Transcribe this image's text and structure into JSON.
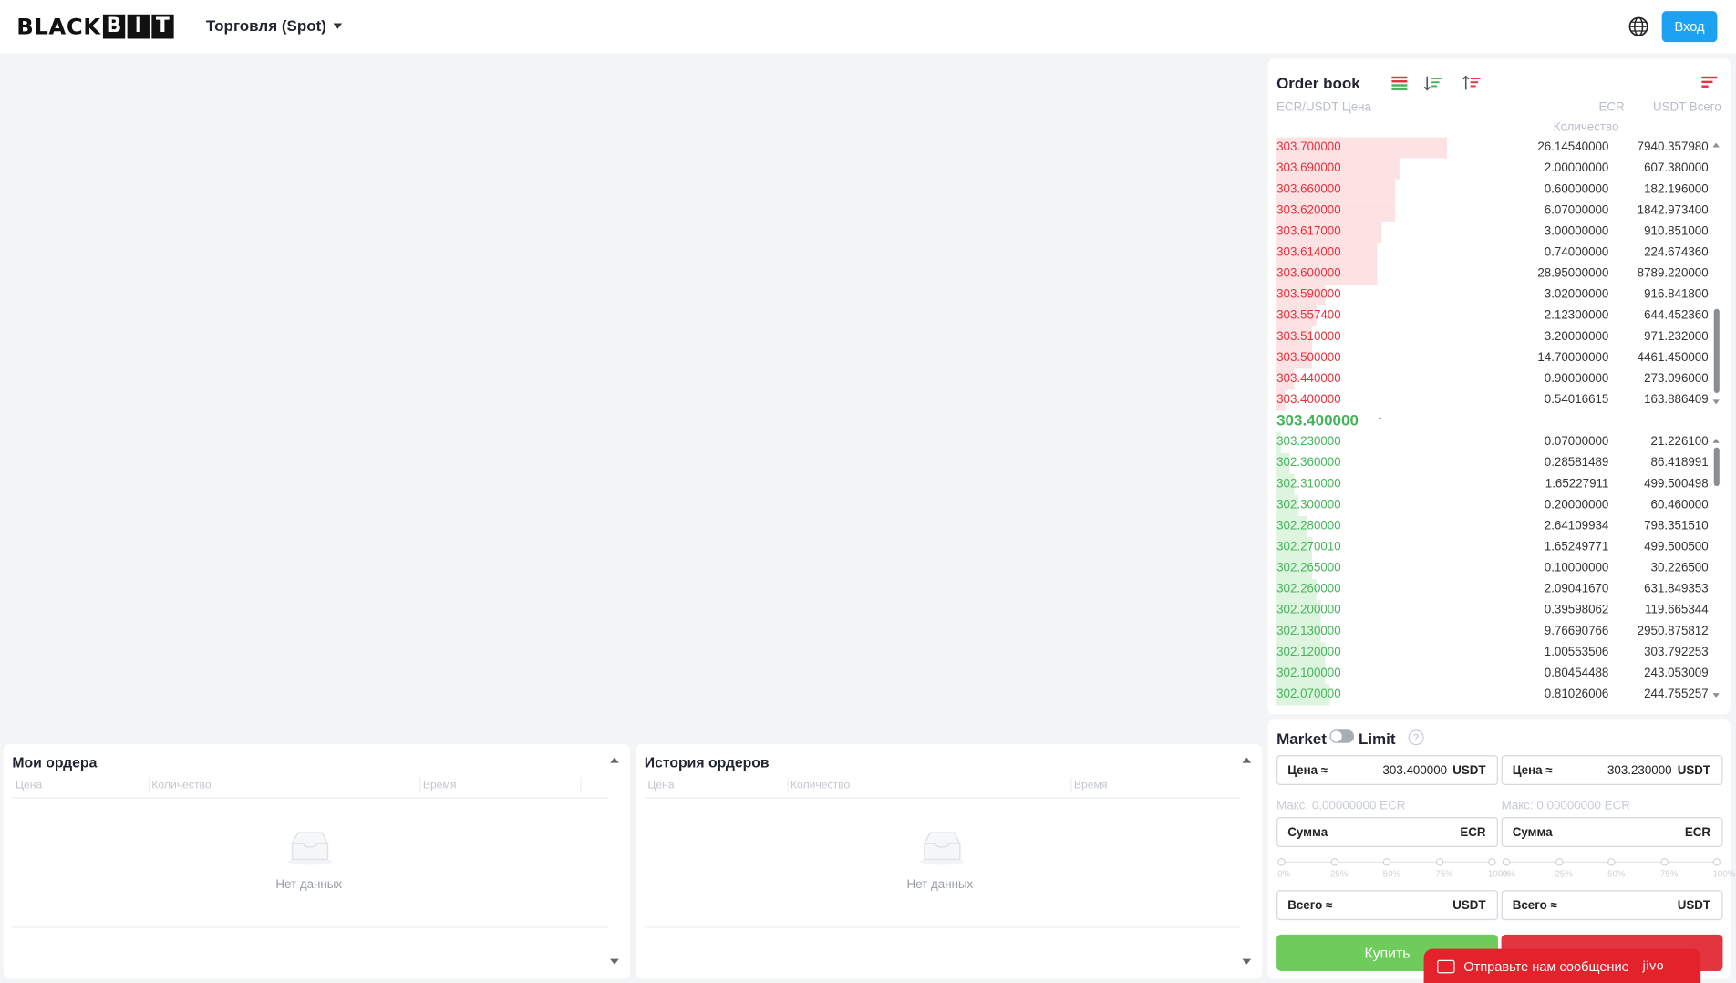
{
  "header": {
    "logo_prefix": "BLACK",
    "logo_boxed": [
      "B",
      "I",
      "T"
    ],
    "trade_menu": "Торговля (Spot)",
    "login": "Вход"
  },
  "orderbook": {
    "title": "Order book",
    "col_price": "ECR/USDT Цена",
    "col_qty_unit": "ECR",
    "col_qty": "Количество",
    "col_total": "USDT Всего",
    "asks": [
      {
        "price": "303.700000",
        "qty": "26.14540000",
        "total": "7940.357980",
        "depth": 0.39
      },
      {
        "price": "303.690000",
        "qty": "2.00000000",
        "total": "607.380000",
        "depth": 0.28
      },
      {
        "price": "303.660000",
        "qty": "0.60000000",
        "total": "182.196000",
        "depth": 0.27
      },
      {
        "price": "303.620000",
        "qty": "6.07000000",
        "total": "1842.973400",
        "depth": 0.27
      },
      {
        "price": "303.617000",
        "qty": "3.00000000",
        "total": "910.851000",
        "depth": 0.24
      },
      {
        "price": "303.614000",
        "qty": "0.74000000",
        "total": "224.674360",
        "depth": 0.23
      },
      {
        "price": "303.600000",
        "qty": "28.95000000",
        "total": "8789.220000",
        "depth": 0.23
      },
      {
        "price": "303.590000",
        "qty": "3.02000000",
        "total": "916.841800",
        "depth": 0.11
      },
      {
        "price": "303.557400",
        "qty": "2.12300000",
        "total": "644.452360",
        "depth": 0.09
      },
      {
        "price": "303.510000",
        "qty": "3.20000000",
        "total": "971.232000",
        "depth": 0.08
      },
      {
        "price": "303.500000",
        "qty": "14.70000000",
        "total": "4461.450000",
        "depth": 0.08
      },
      {
        "price": "303.440000",
        "qty": "0.90000000",
        "total": "273.096000",
        "depth": 0.04
      },
      {
        "price": "303.400000",
        "qty": "0.54016615",
        "total": "163.886409",
        "depth": 0.02
      }
    ],
    "last_price": "303.400000",
    "last_arrow": "↑",
    "bids": [
      {
        "price": "303.230000",
        "qty": "0.07000000",
        "total": "21.226100",
        "depth": 0.01
      },
      {
        "price": "302.360000",
        "qty": "0.28581489",
        "total": "86.418991",
        "depth": 0.03
      },
      {
        "price": "302.310000",
        "qty": "1.65227911",
        "total": "499.500498",
        "depth": 0.04
      },
      {
        "price": "302.300000",
        "qty": "0.20000000",
        "total": "60.460000",
        "depth": 0.05
      },
      {
        "price": "302.280000",
        "qty": "2.64109934",
        "total": "798.351510",
        "depth": 0.07
      },
      {
        "price": "302.270010",
        "qty": "1.65249771",
        "total": "499.500500",
        "depth": 0.08
      },
      {
        "price": "302.265000",
        "qty": "0.10000000",
        "total": "30.226500",
        "depth": 0.08
      },
      {
        "price": "302.260000",
        "qty": "2.09041670",
        "total": "631.849353",
        "depth": 0.09
      },
      {
        "price": "302.200000",
        "qty": "0.39598062",
        "total": "119.665344",
        "depth": 0.1
      },
      {
        "price": "302.130000",
        "qty": "9.76690766",
        "total": "2950.875812",
        "depth": 0.1
      },
      {
        "price": "302.120000",
        "qty": "1.00553506",
        "total": "303.792253",
        "depth": 0.11
      },
      {
        "price": "302.100000",
        "qty": "0.80454488",
        "total": "243.053009",
        "depth": 0.11
      },
      {
        "price": "302.070000",
        "qty": "0.81026006",
        "total": "244.755257",
        "depth": 0.12
      }
    ]
  },
  "trade_form": {
    "market": "Market",
    "limit": "Limit",
    "help": "?",
    "buy": {
      "price_label": "Цена ≈",
      "price_value": "303.400000",
      "price_unit": "USDT",
      "max": "Макс: 0.00000000 ECR",
      "amount_label": "Сумма",
      "amount_unit": "ECR",
      "total_label": "Всего ≈",
      "total_unit": "USDT",
      "button": "Купить"
    },
    "sell": {
      "price_label": "Цена ≈",
      "price_value": "303.230000",
      "price_unit": "USDT",
      "max": "Макс: 0.00000000 ECR",
      "amount_label": "Сумма",
      "amount_unit": "ECR",
      "total_label": "Всего ≈",
      "total_unit": "USDT"
    },
    "slider_marks": [
      "0%",
      "25%",
      "50%",
      "75%",
      "100%"
    ]
  },
  "my_orders": {
    "title": "Мои ордера",
    "col_price": "Цена",
    "col_qty": "Количество",
    "col_time": "Время",
    "empty": "Нет данных"
  },
  "order_history": {
    "title": "История ордеров",
    "col_price": "Цена",
    "col_qty": "Количество",
    "col_time": "Время",
    "empty": "Нет данных"
  },
  "chat": {
    "label": "Отправьте нам сообщение",
    "brand": "jivo"
  },
  "colors": {
    "accent": "#1da1f2",
    "ask": "#e0343f",
    "bid": "#46b35a",
    "buy_button": "#6dcc5a",
    "sell_button": "#e3353f",
    "chat": "#e3222c"
  }
}
